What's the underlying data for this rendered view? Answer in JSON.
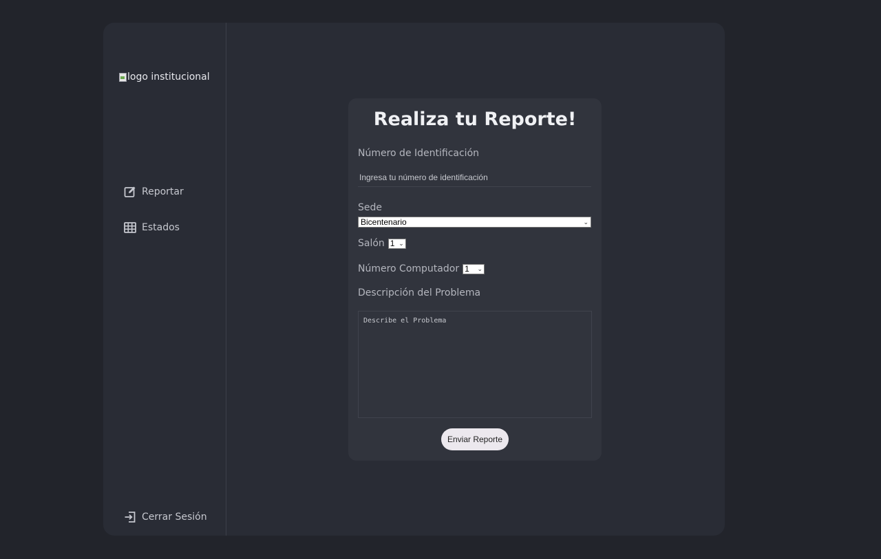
{
  "sidebar": {
    "logo_alt": "logo institucional",
    "nav": [
      {
        "label": "Reportar",
        "icon": "edit-square-icon"
      },
      {
        "label": "Estados",
        "icon": "table-grid-icon"
      }
    ],
    "logout_label": "Cerrar Sesión",
    "logout_icon": "sign-out-icon"
  },
  "form": {
    "title": "Realiza tu Reporte!",
    "id_label": "Número de Identificación",
    "id_placeholder": "Ingresa tu número de identificación",
    "sede_label": "Sede",
    "sede_value": "Bicentenario",
    "salon_label": "Salón",
    "salon_value": "1",
    "pc_label": "Número Computador",
    "pc_value": "1",
    "desc_label": "Descripción del Problema",
    "desc_placeholder": "Describe el Problema",
    "submit_label": "Enviar Reporte"
  },
  "colors": {
    "page_bg": "#22242b",
    "panel_bg": "#292c35",
    "card_bg": "#31343d",
    "button_bg": "#ece8ee"
  }
}
